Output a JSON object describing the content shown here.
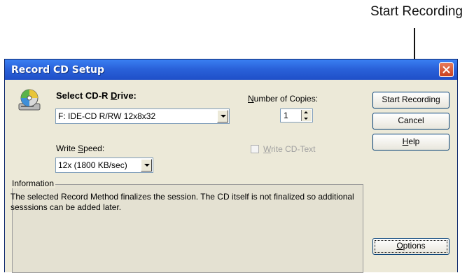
{
  "annotation": {
    "callout_text": "Start Recording"
  },
  "window": {
    "title": "Record CD Setup"
  },
  "drive": {
    "label_pre": "Select CD-R ",
    "label_u": "D",
    "label_post": "rive:",
    "value": "F: IDE-CD R/RW 12x8x32"
  },
  "copies": {
    "label_u": "N",
    "label_post": "umber of Copies:",
    "value": "1"
  },
  "speed": {
    "label_pre": "Write ",
    "label_u": "S",
    "label_post": "peed:",
    "value": "12x (1800 KB/sec)"
  },
  "cdtext": {
    "label_u": "W",
    "label_post": "rite CD-Text",
    "checked": false,
    "enabled": false
  },
  "info": {
    "legend": "Information",
    "text": "The selected Record Method finalizes the session. The CD itself is not finalized so additional sesssions can be added later."
  },
  "buttons": {
    "start": "Start Recording",
    "cancel": "Cancel",
    "help_u": "H",
    "help_post": "elp",
    "options_u": "O",
    "options_post": "ptions"
  },
  "colors": {
    "titlebar": "#2a62da",
    "dialog": "#ece9d8",
    "close": "#c8401f"
  }
}
